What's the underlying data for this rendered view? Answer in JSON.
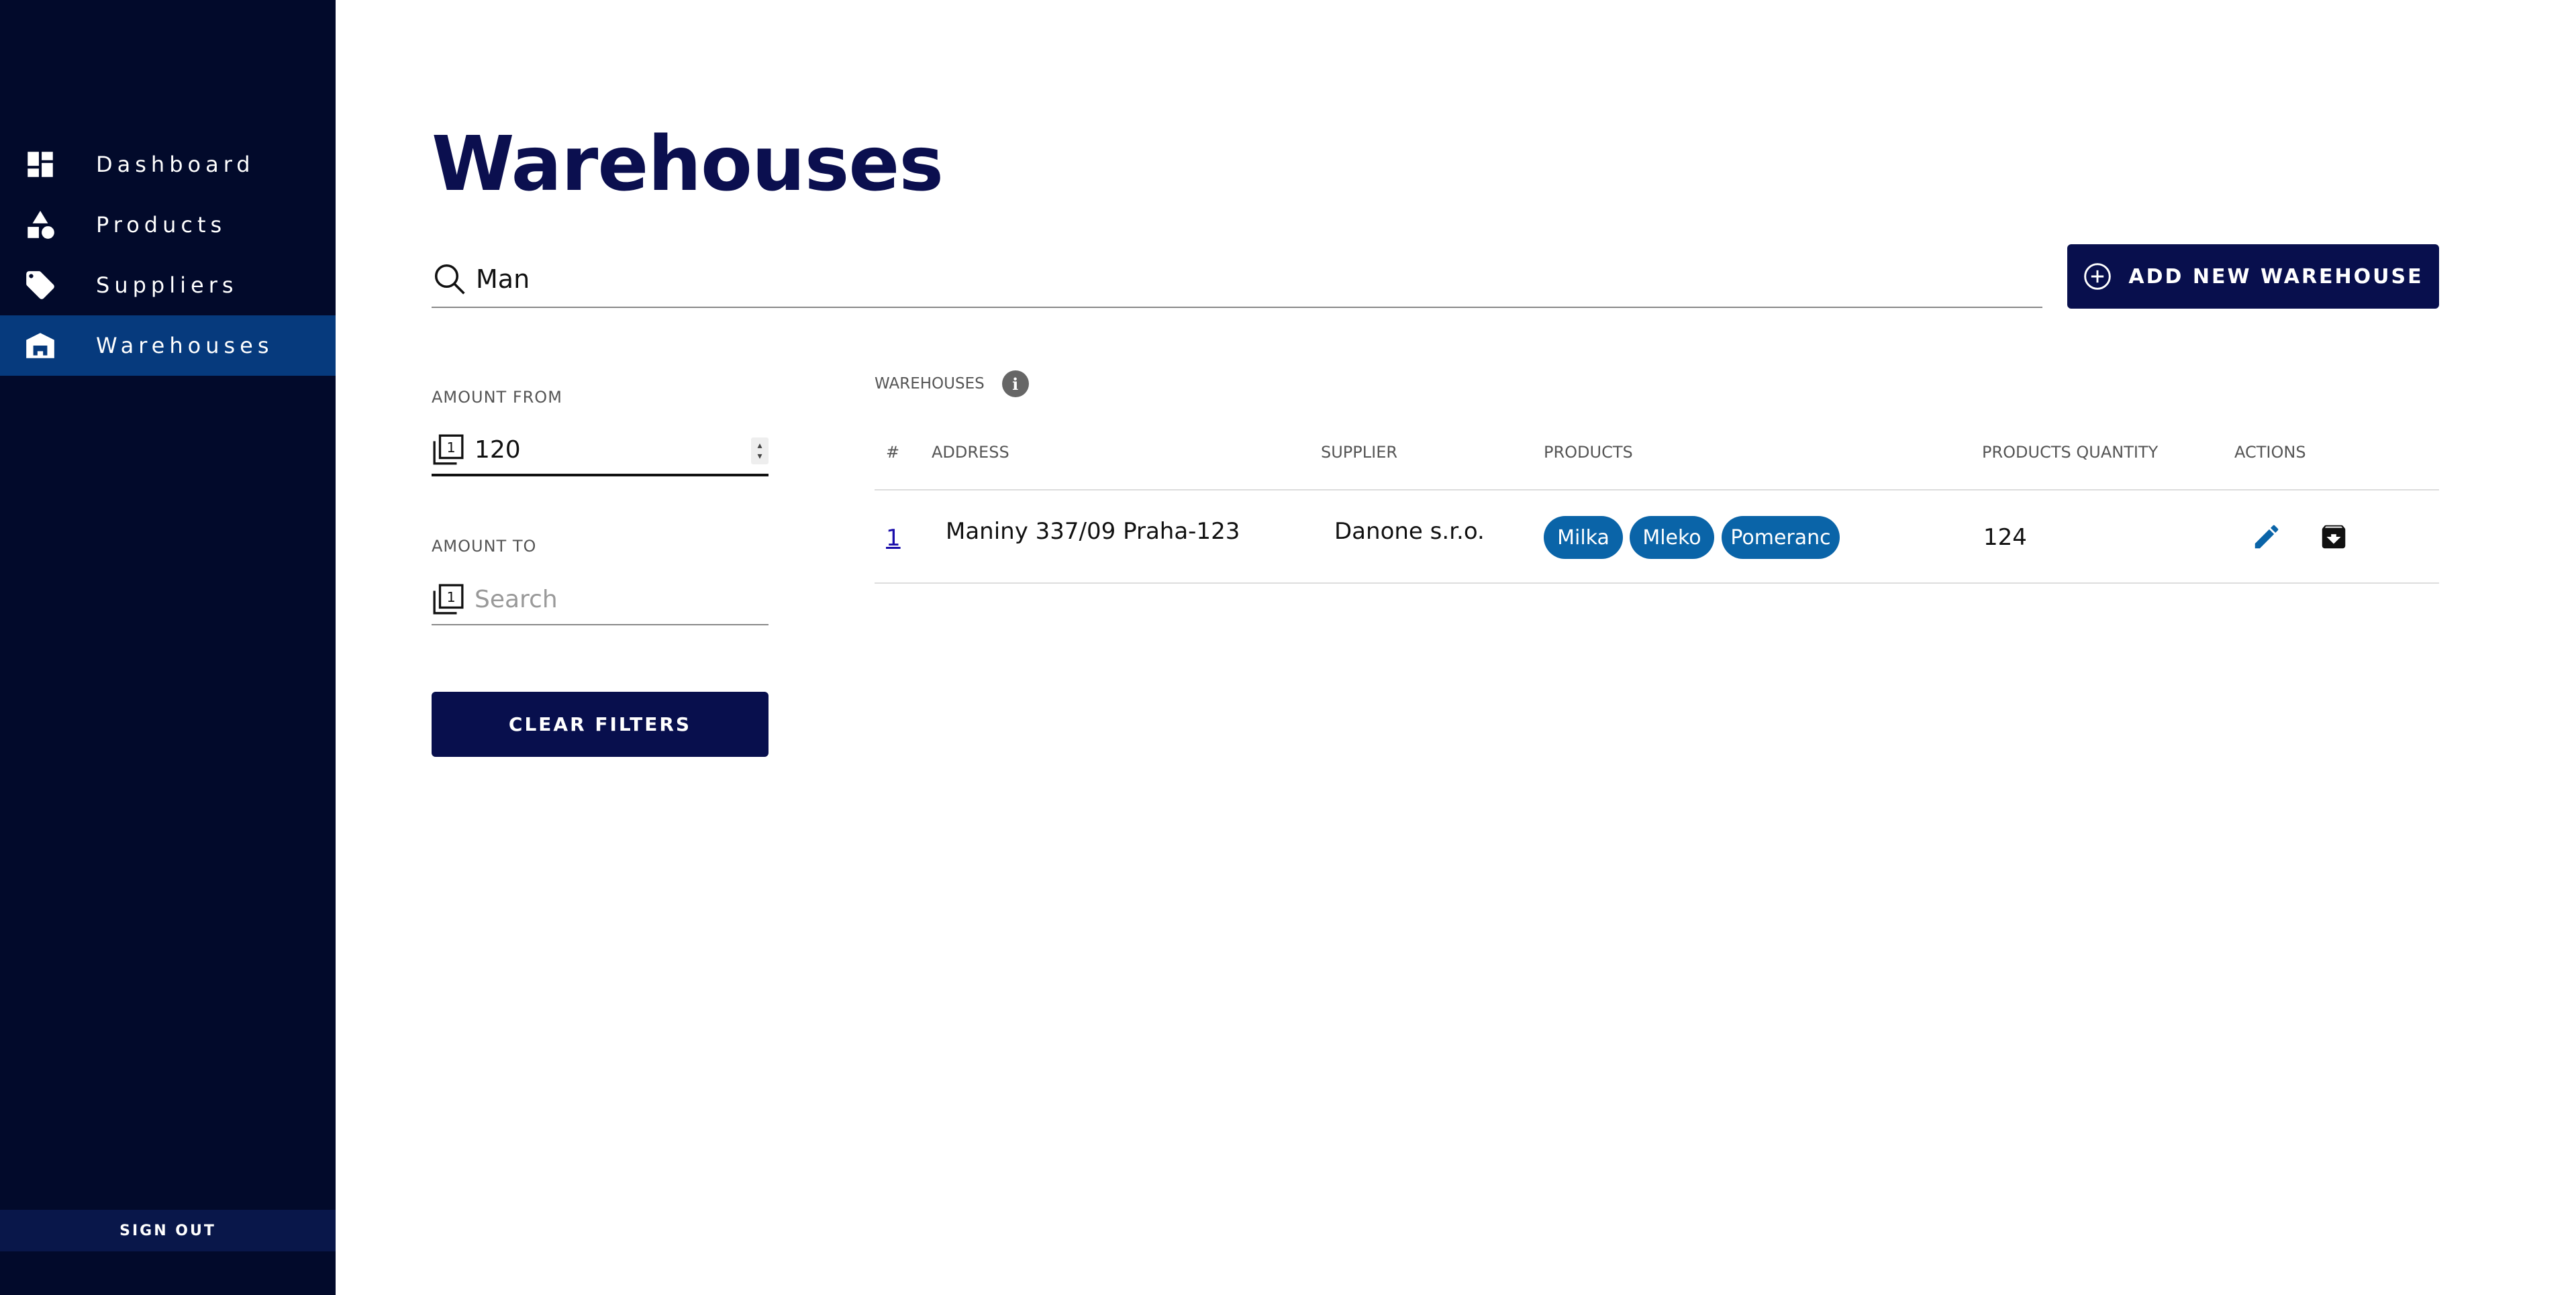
{
  "sidebar": {
    "items": [
      {
        "label": "Dashboard",
        "icon": "dashboard-icon"
      },
      {
        "label": "Products",
        "icon": "shapes-icon"
      },
      {
        "label": "Suppliers",
        "icon": "tag-icon"
      },
      {
        "label": "Warehouses",
        "icon": "warehouse-icon",
        "active": true
      }
    ],
    "sign_out": "SIGN OUT"
  },
  "page": {
    "title": "Warehouses"
  },
  "search": {
    "value": "Man",
    "icon": "search-icon"
  },
  "add_button": {
    "label": "ADD NEW WAREHOUSE",
    "icon": "plus-circle-icon"
  },
  "filters": {
    "amount_from": {
      "label": "AMOUNT FROM",
      "value": "120"
    },
    "amount_to": {
      "label": "AMOUNT TO",
      "placeholder": "Search"
    },
    "clear_label": "CLEAR FILTERS"
  },
  "table": {
    "title": "WAREHOUSES",
    "info_glyph": "i",
    "columns": [
      "#",
      "ADDRESS",
      "SUPPLIER",
      "PRODUCTS",
      "PRODUCTS QUANTITY",
      "ACTIONS"
    ],
    "rows": [
      {
        "id": "1",
        "address": "Maniny 337/09 Praha-123",
        "supplier": "Danone s.r.o.",
        "products": [
          "Milka",
          "Mleko",
          "Pomeranc"
        ],
        "quantity": "124"
      }
    ]
  },
  "colors": {
    "sidebar_bg": "#020a2b",
    "sidebar_active": "#063a7d",
    "primary": "#080f4d",
    "chip": "#0a64a8"
  }
}
